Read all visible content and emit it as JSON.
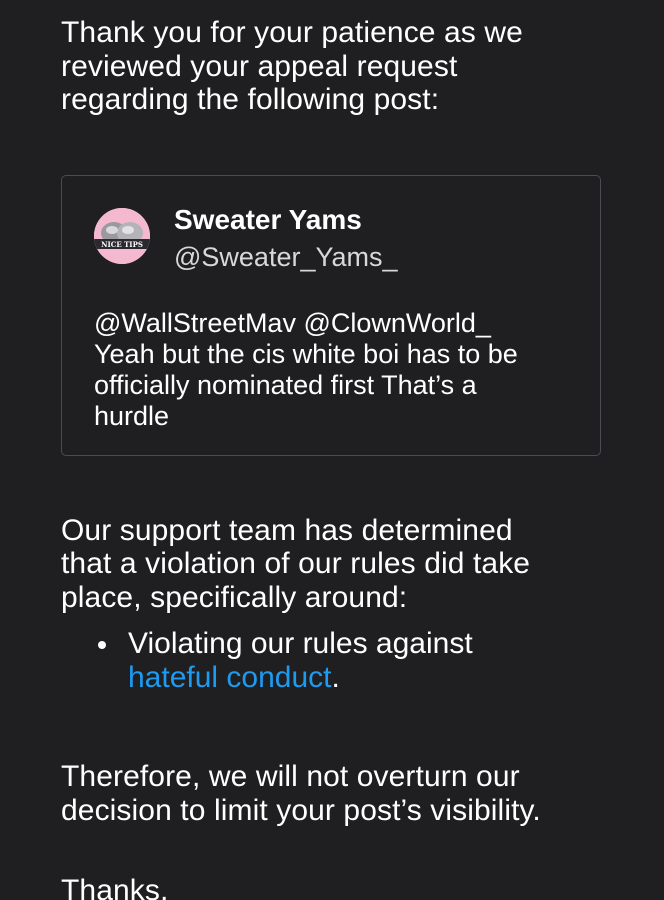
{
  "intro": {
    "line1": "Thank you for your patience as we",
    "line2": "reviewed your appeal request",
    "line3": "regarding the following post:"
  },
  "post": {
    "author_name": "Sweater Yams",
    "author_handle": "@Sweater_Yams_",
    "avatar_text": "NICE TIPS",
    "text_line1": "@WallStreetMav @ClownWorld_",
    "text_line2": "Yeah but the cis white boi has to be",
    "text_line3": "officially nominated first That’s a",
    "text_line4": "hurdle"
  },
  "determination": {
    "line1": "Our support team has determined",
    "line2": "that a violation of our rules did take",
    "line3": "place, specifically around:"
  },
  "violation": {
    "line1": "Violating our rules against",
    "link_text": "hateful conduct",
    "suffix": "."
  },
  "decision": {
    "line1": "Therefore, we will not overturn our",
    "line2": "decision to limit your post’s visibility."
  },
  "closing": {
    "thanks": "Thanks,"
  },
  "colors": {
    "background": "#1f1f21",
    "link": "#1d9bf0",
    "card_border": "#4a4c52",
    "avatar_bg": "#f4b8cf"
  }
}
